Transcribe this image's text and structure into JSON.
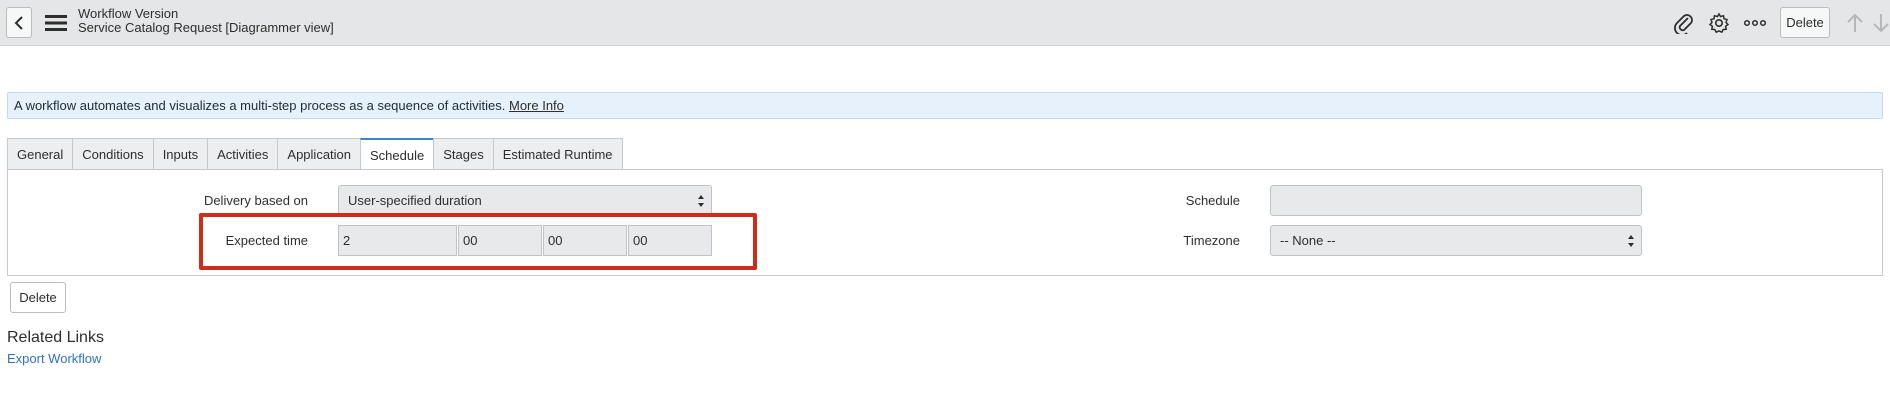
{
  "header": {
    "back_icon": "chevron-left-icon",
    "menu_icon": "hamburger-icon",
    "title": "Workflow Version",
    "subtitle": "Service Catalog Request [Diagrammer view]",
    "attachment_icon": "paperclip-icon",
    "settings_icon": "gear-icon",
    "more_icon": "more-options-icon",
    "delete_label": "Delete",
    "up_icon": "arrow-up-icon",
    "down_icon": "arrow-down-icon"
  },
  "info": {
    "message": "A workflow automates and visualizes a multi-step process as a sequence of activities.",
    "link": "More Info"
  },
  "tabs": [
    {
      "label": "General"
    },
    {
      "label": "Conditions"
    },
    {
      "label": "Inputs"
    },
    {
      "label": "Activities"
    },
    {
      "label": "Application"
    },
    {
      "label": "Schedule",
      "active": true
    },
    {
      "label": "Stages"
    },
    {
      "label": "Estimated Runtime"
    }
  ],
  "form": {
    "delivery_label": "Delivery based on",
    "delivery_value": "User-specified duration",
    "expected_label": "Expected time",
    "expected_days": "2",
    "expected_hours": "00",
    "expected_minutes": "00",
    "expected_seconds": "00",
    "schedule_label": "Schedule",
    "schedule_value": "",
    "timezone_label": "Timezone",
    "timezone_value": "-- None --"
  },
  "colors": {
    "highlight": "#cf2d1c",
    "link": "#2f72c4",
    "active_tab": "#3b83c5"
  },
  "actions": {
    "delete_label": "Delete"
  },
  "related": {
    "title": "Related Links",
    "export_link": "Export Workflow"
  }
}
